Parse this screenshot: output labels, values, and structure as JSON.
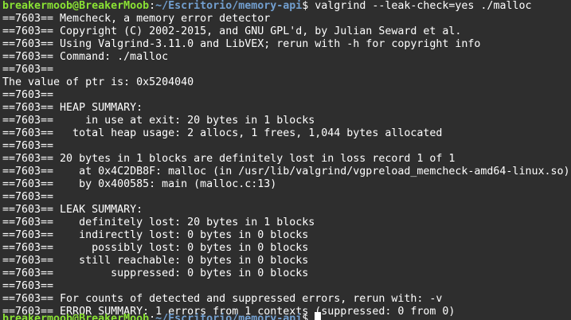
{
  "terminal": {
    "prompt": {
      "user_host": "breakermoob@BreakerMoob",
      "separator": ":",
      "path": "~/Escritorio/memory-api",
      "symbol": "$",
      "command": " valgrind --leak-check=yes ./malloc"
    },
    "output_lines": [
      "==7603== Memcheck, a memory error detector",
      "==7603== Copyright (C) 2002-2015, and GNU GPL'd, by Julian Seward et al.",
      "==7603== Using Valgrind-3.11.0 and LibVEX; rerun with -h for copyright info",
      "==7603== Command: ./malloc",
      "==7603==",
      "The value of ptr is: 0x5204040",
      "==7603==",
      "==7603== HEAP SUMMARY:",
      "==7603==     in use at exit: 20 bytes in 1 blocks",
      "==7603==   total heap usage: 2 allocs, 1 frees, 1,044 bytes allocated",
      "==7603==",
      "==7603== 20 bytes in 1 blocks are definitely lost in loss record 1 of 1",
      "==7603==    at 0x4C2DB8F: malloc (in /usr/lib/valgrind/vgpreload_memcheck-amd64-linux.so)",
      "==7603==    by 0x400585: main (malloc.c:13)",
      "==7603==",
      "==7603== LEAK SUMMARY:",
      "==7603==    definitely lost: 20 bytes in 1 blocks",
      "==7603==    indirectly lost: 0 bytes in 0 blocks",
      "==7603==      possibly lost: 0 bytes in 0 blocks",
      "==7603==    still reachable: 0 bytes in 0 blocks",
      "==7603==         suppressed: 0 bytes in 0 blocks",
      "==7603==",
      "==7603== For counts of detected and suppressed errors, rerun with: -v",
      "==7603== ERROR SUMMARY: 1 errors from 1 contexts (suppressed: 0 from 0)"
    ],
    "colors": {
      "background": "#2e2e2e",
      "text": "#ffffff",
      "user_host": "#8ae234",
      "path": "#729fcf"
    }
  }
}
